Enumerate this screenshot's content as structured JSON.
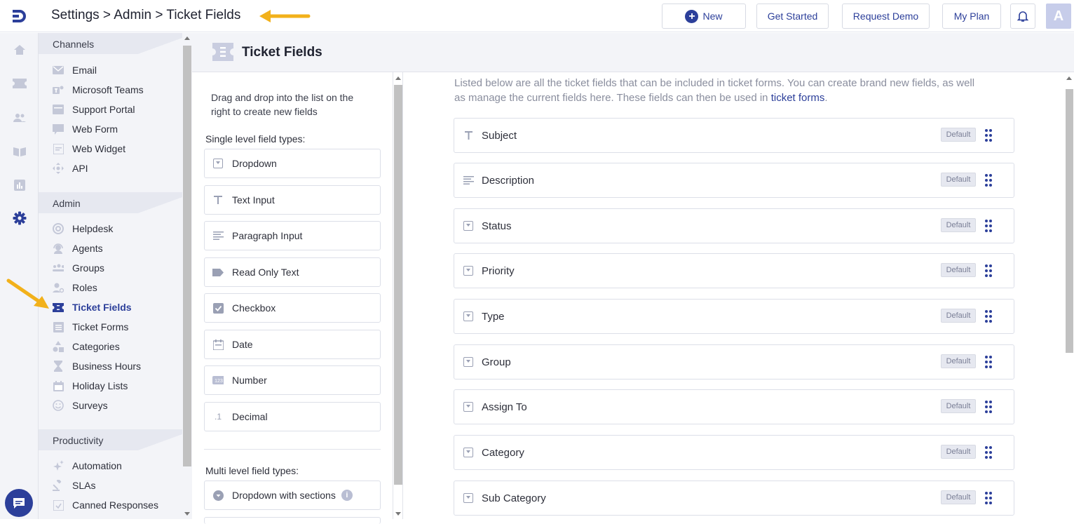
{
  "topbar": {
    "breadcrumb": "Settings > Admin > Ticket Fields",
    "new_label": "New",
    "get_started_label": "Get Started",
    "request_demo_label": "Request Demo",
    "my_plan_label": "My Plan",
    "avatar_initial": "A"
  },
  "colors": {
    "accent": "#2c3f9a",
    "arrow": "#f2b11b"
  },
  "nav": {
    "channels_title": "Channels",
    "channels": [
      {
        "label": "Email",
        "icon": "email-icon"
      },
      {
        "label": "Microsoft Teams",
        "icon": "teams-icon"
      },
      {
        "label": "Support Portal",
        "icon": "portal-icon"
      },
      {
        "label": "Web Form",
        "icon": "webform-icon"
      },
      {
        "label": "Web Widget",
        "icon": "widget-icon"
      },
      {
        "label": "API",
        "icon": "api-icon"
      }
    ],
    "admin_title": "Admin",
    "admin": [
      {
        "label": "Helpdesk",
        "icon": "helpdesk-icon"
      },
      {
        "label": "Agents",
        "icon": "agent-icon"
      },
      {
        "label": "Groups",
        "icon": "groups-icon"
      },
      {
        "label": "Roles",
        "icon": "roles-icon"
      },
      {
        "label": "Ticket Fields",
        "icon": "ticket-icon"
      },
      {
        "label": "Ticket Forms",
        "icon": "form-icon"
      },
      {
        "label": "Categories",
        "icon": "categories-icon"
      },
      {
        "label": "Business Hours",
        "icon": "hourglass-icon"
      },
      {
        "label": "Holiday Lists",
        "icon": "calendar-icon"
      },
      {
        "label": "Surveys",
        "icon": "smiley-icon"
      }
    ],
    "productivity_title": "Productivity",
    "productivity": [
      {
        "label": "Automation",
        "icon": "sparkle-icon"
      },
      {
        "label": "SLAs",
        "icon": "gavel-icon"
      },
      {
        "label": "Canned Responses",
        "icon": "canned-icon"
      }
    ]
  },
  "page": {
    "title": "Ticket Fields"
  },
  "palette": {
    "instructions": "Drag and drop into the list on the right to create new fields",
    "single_title": "Single level field types:",
    "single": [
      "Dropdown",
      "Text Input",
      "Paragraph Input",
      "Read Only Text",
      "Checkbox",
      "Date",
      "Number",
      "Decimal"
    ],
    "multi_title": "Multi level field types:",
    "multi": [
      "Dropdown with sections"
    ]
  },
  "main": {
    "description": "Listed below are all the ticket fields that can be included in ticket forms. You can create brand new fields, as well as manage the current fields here. These fields can then be used in",
    "description_link": "ticket forms",
    "badge": "Default",
    "fields": [
      {
        "name": "Subject",
        "icon": "text-icon"
      },
      {
        "name": "Description",
        "icon": "paragraph-icon"
      },
      {
        "name": "Status",
        "icon": "dropdown-icon"
      },
      {
        "name": "Priority",
        "icon": "dropdown-icon"
      },
      {
        "name": "Type",
        "icon": "dropdown-icon"
      },
      {
        "name": "Group",
        "icon": "dropdown-icon"
      },
      {
        "name": "Assign To",
        "icon": "dropdown-icon"
      },
      {
        "name": "Category",
        "icon": "dropdown-icon"
      },
      {
        "name": "Sub Category",
        "icon": "dropdown-icon"
      }
    ]
  }
}
